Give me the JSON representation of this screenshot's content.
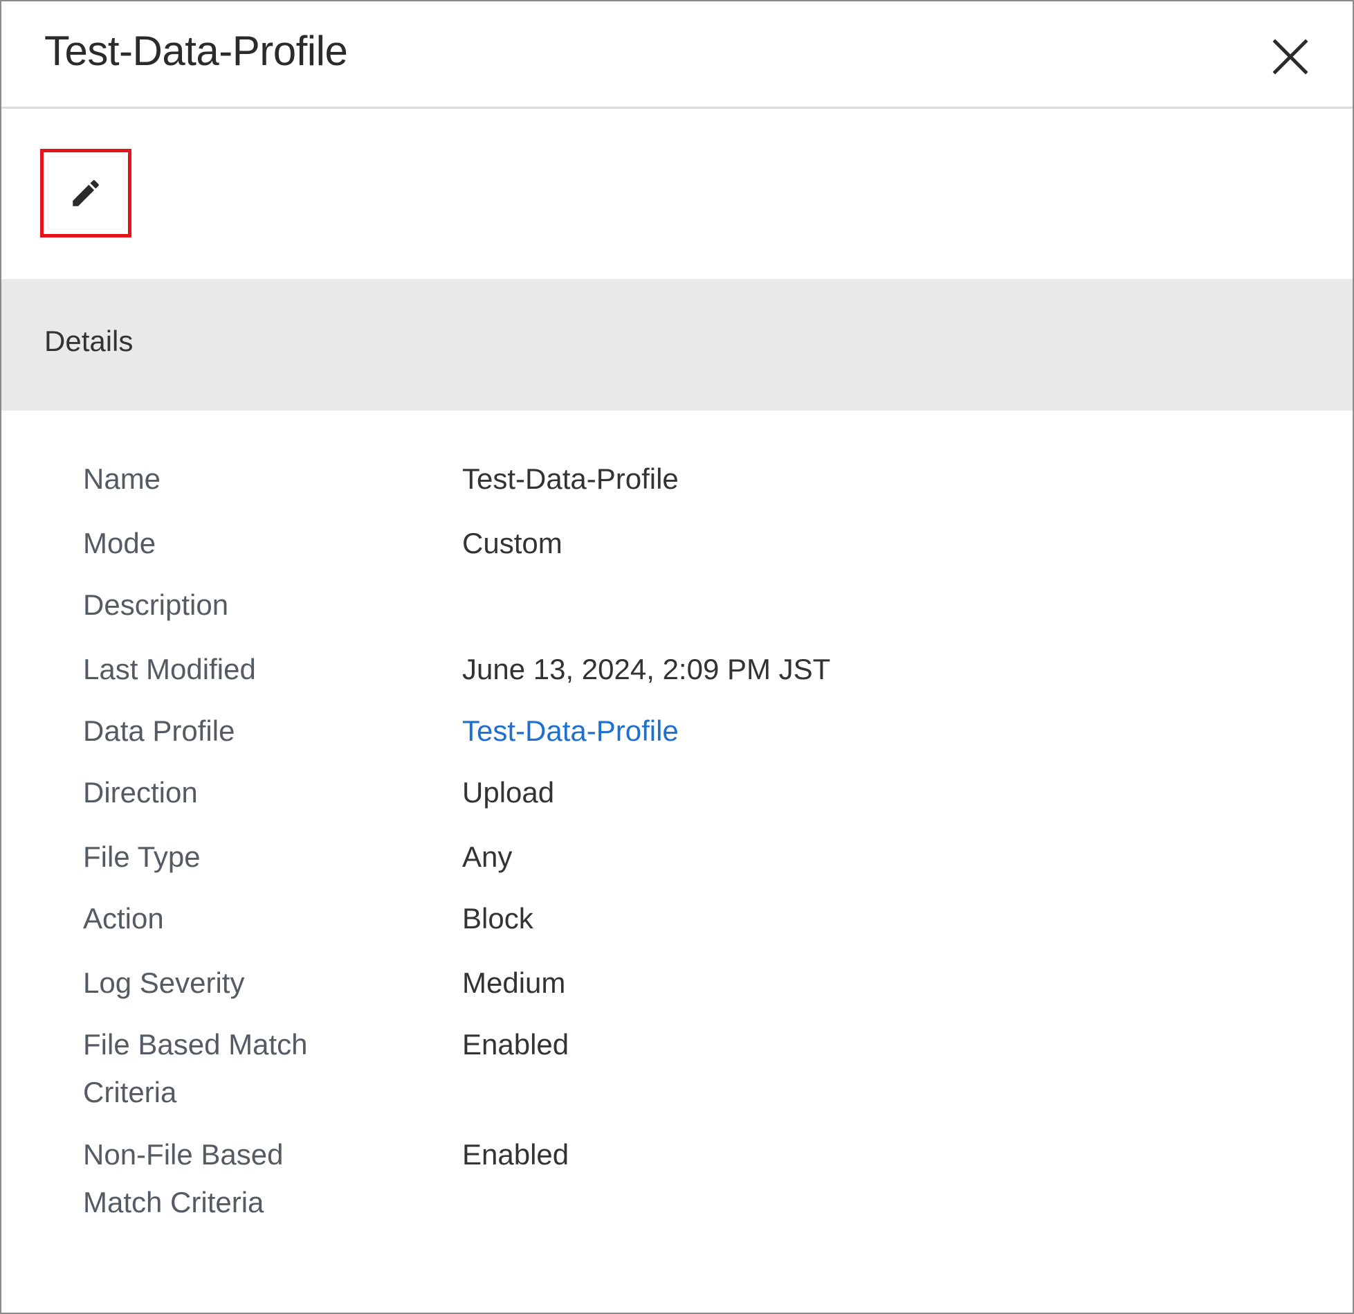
{
  "header": {
    "title": "Test-Data-Profile",
    "close_icon": "close-icon"
  },
  "toolbar": {
    "edit_icon": "pencil-icon",
    "highlight_color": "#e5141b"
  },
  "section": {
    "title": "Details"
  },
  "details": {
    "name": {
      "label": "Name",
      "value": "Test-Data-Profile"
    },
    "mode": {
      "label": "Mode",
      "value": "Custom"
    },
    "description": {
      "label": "Description",
      "value": ""
    },
    "last_modified": {
      "label": "Last Modified",
      "value": "June 13, 2024, 2:09 PM JST"
    },
    "data_profile": {
      "label": "Data Profile",
      "value": "Test-Data-Profile"
    },
    "direction": {
      "label": "Direction",
      "value": "Upload"
    },
    "file_type": {
      "label": "File Type",
      "value": "Any"
    },
    "action": {
      "label": "Action",
      "value": "Block"
    },
    "log_severity": {
      "label": "Log Severity",
      "value": "Medium"
    },
    "file_based_match": {
      "label_line1": "File Based Match",
      "label_line2": "Criteria",
      "value": "Enabled"
    },
    "non_file_based_match": {
      "label_line1": "Non-File Based",
      "label_line2": "Match Criteria",
      "value": "Enabled"
    }
  },
  "colors": {
    "link": "#1f6fcf",
    "section_bg": "#e8eaea",
    "label_text": "#555b62",
    "value_text": "#333333"
  }
}
